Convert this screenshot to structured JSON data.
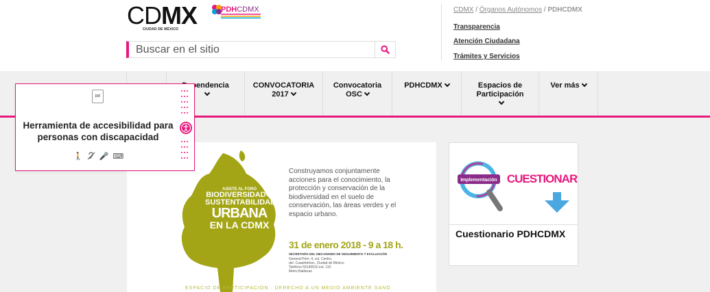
{
  "header": {
    "logo_cdmx": {
      "part1": "CD",
      "part2": "MX",
      "subtitle": "CIUDAD DE MÉXICO"
    },
    "logo_pdh": {
      "part1": "PDH",
      "part2": "CDMX"
    },
    "search": {
      "placeholder": "Buscar en el sitio"
    },
    "breadcrumb": {
      "item1": "CDMX",
      "sep1": " / ",
      "item2": "Órganos Autónomos",
      "sep2": " / ",
      "current": "PDHCDMX"
    },
    "links": [
      "Transparencia",
      "Atención Ciudadana",
      "Trámites y Servicios"
    ]
  },
  "nav": {
    "items": [
      {
        "label": "Dependencia"
      },
      {
        "label": "CONVOCATORIA 2017"
      },
      {
        "label": "Convocatoria OSC"
      },
      {
        "label": "PDHCDMX"
      },
      {
        "label": "Espacios de Participación"
      },
      {
        "label": "Ver más"
      }
    ]
  },
  "accessibility": {
    "badge": "DIF",
    "title": "Herramienta de accesibilidad para personas con discapacidad"
  },
  "banner": {
    "text": "Construyamos conjuntamente acciones para el conocimiento, la protección y conservación de la biodiversidad en el suelo de conservación, las áreas verdes y el espacio urbano.",
    "title_small": "ASISTE AL FORO",
    "title_mid1": "BIODIVERSIDAD Y",
    "title_mid2": "SUSTENTABILIDAD",
    "title_big": "URBANA",
    "title_end": "EN LA CDMX",
    "date": "31 de enero 2018 - 9 a 18 h.",
    "org": "SECRETARÍA DEL MECANISMO DE SEGUIMIENTO Y EVALUACIÓN",
    "address": "General Prim, 4, col. Centro,\ndel. Cuauhtémoc, Ciudad de México\nTeléfono 55140610 ext. 110\nMetro Balderas",
    "footer": "ESPACIO DE PARTICIPACIÓN · DERECHO A UN MEDIO AMBIENTE SANO"
  },
  "card": {
    "tag": "Implementación",
    "heading": "CUESTIONARIO",
    "title": "Cuestionario PDHCDMX"
  },
  "colors": {
    "accent": "#e8177d",
    "nav_bg": "#f0f0f0",
    "olive": "#a3a516"
  }
}
